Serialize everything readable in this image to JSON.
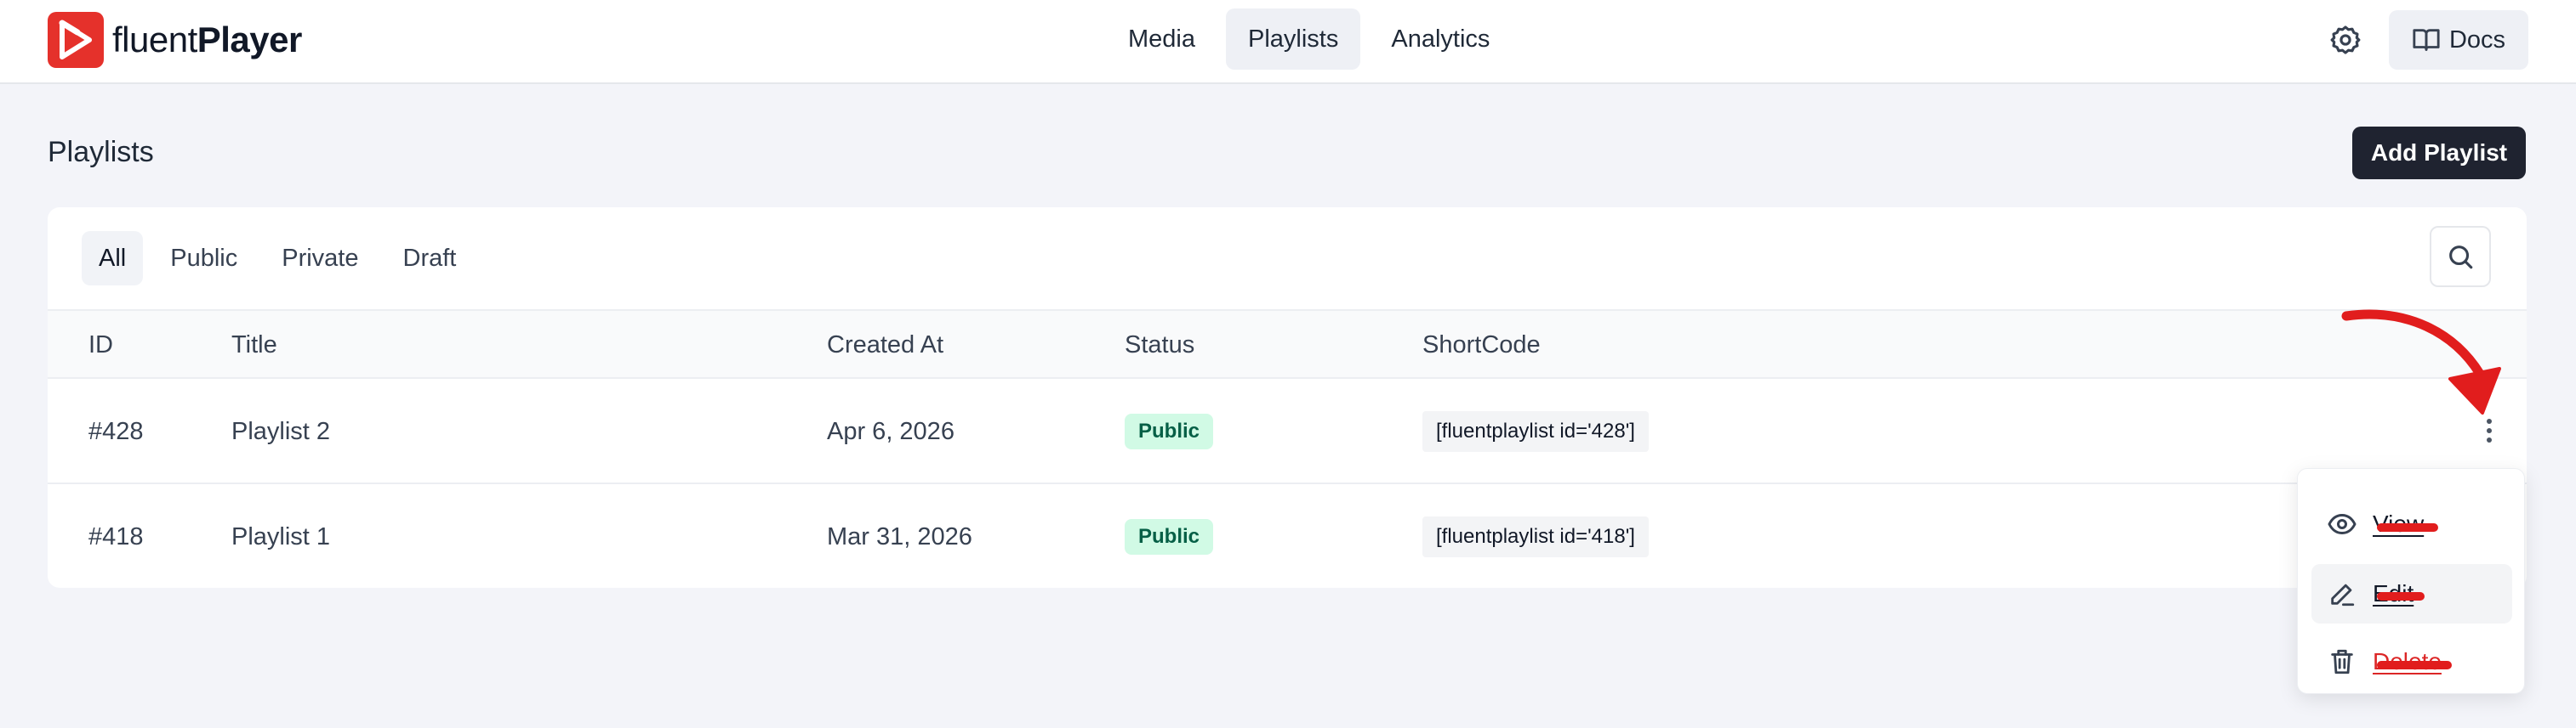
{
  "brand": {
    "name_light": "fluent",
    "name_bold": "Player",
    "accent": "#e5312b"
  },
  "nav": {
    "items": [
      {
        "label": "Media",
        "active": false
      },
      {
        "label": "Playlists",
        "active": true
      },
      {
        "label": "Analytics",
        "active": false
      }
    ],
    "docs_label": "Docs",
    "settings_icon": "gear-icon"
  },
  "page": {
    "title": "Playlists",
    "add_button_label": "Add Playlist"
  },
  "filters": {
    "tabs": [
      {
        "label": "All",
        "active": true
      },
      {
        "label": "Public",
        "active": false
      },
      {
        "label": "Private",
        "active": false
      },
      {
        "label": "Draft",
        "active": false
      }
    ],
    "search_icon": "search-icon"
  },
  "table": {
    "columns": {
      "id": "ID",
      "title": "Title",
      "created": "Created At",
      "status": "Status",
      "shortcode": "ShortCode"
    },
    "rows": [
      {
        "id": "#428",
        "title": "Playlist 2",
        "created": "Apr 6, 2026",
        "status": "Public",
        "shortcode": "[fluentplaylist id='428']"
      },
      {
        "id": "#418",
        "title": "Playlist 1",
        "created": "Mar 31, 2026",
        "status": "Public",
        "shortcode": "[fluentplaylist id='418']"
      }
    ]
  },
  "row_menu": {
    "items": [
      {
        "label": "View",
        "icon": "eye-icon"
      },
      {
        "label": "Edit",
        "icon": "pencil-icon"
      },
      {
        "label": "Delete",
        "icon": "trash-icon"
      }
    ]
  },
  "colors": {
    "danger": "#dc2626",
    "badge_bg": "#d1fae5",
    "badge_text": "#065f46",
    "annotation": "#e11d1d"
  }
}
